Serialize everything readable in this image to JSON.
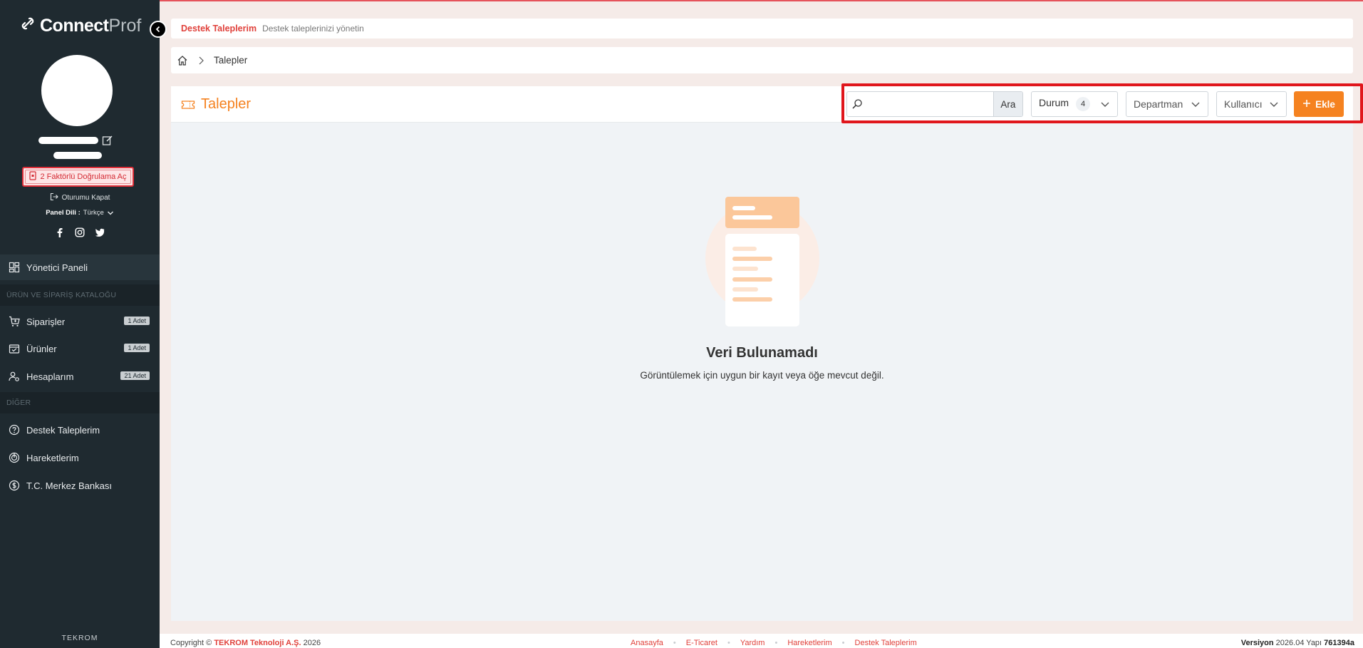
{
  "sidebar": {
    "brand_bold": "Connect",
    "brand_light": "Prof",
    "twofa_label": "2 Faktörlü Doğrulama Aç",
    "logout_label": "Oturumu Kapat",
    "lang_label": "Panel Dili :",
    "lang_value": "Türkçe",
    "menu": [
      {
        "label": "Yönetici Paneli"
      },
      {
        "label": "Siparişler",
        "badge": "1 Adet"
      },
      {
        "label": "Ürünler",
        "badge": "1 Adet"
      },
      {
        "label": "Hesaplarım",
        "badge": "21 Adet"
      },
      {
        "label": "Destek Taleplerim"
      },
      {
        "label": "Hareketlerim"
      },
      {
        "label": "T.C. Merkez Bankası"
      }
    ],
    "sections": [
      "ÜRÜN VE SİPARİŞ KATALOĞU",
      "DİĞER"
    ],
    "footer_brand": "TEKROM"
  },
  "header": {
    "title": "Destek Taleplerim",
    "subtitle": "Destek taleplerinizi yönetin"
  },
  "breadcrumb": {
    "current": "Talepler"
  },
  "page": {
    "title": "Talepler"
  },
  "toolbar": {
    "search_placeholder": "",
    "search_button": "Ara",
    "status_label": "Durum",
    "status_count": "4",
    "department_label": "Departman",
    "user_label": "Kullanıcı",
    "add_label": "Ekle"
  },
  "empty": {
    "title": "Veri Bulunamadı",
    "description": "Görüntülemek için uygun bir kayıt veya öğe mevcut değil."
  },
  "footer": {
    "copyright_prefix": "Copyright ©",
    "company": "TEKROM Teknoloji A.Ş.",
    "year": "2026",
    "links": [
      "Anasayfa",
      "E-Ticaret",
      "Yardım",
      "Hareketlerim",
      "Destek Taleplerim"
    ],
    "version_label": "Versiyon",
    "version": "2026.04",
    "build_label": "Yapı",
    "build": "761394a"
  },
  "colors": {
    "accent": "#f58220",
    "brand_red": "#e0413b",
    "sidebar_bg": "#1f2a30"
  }
}
